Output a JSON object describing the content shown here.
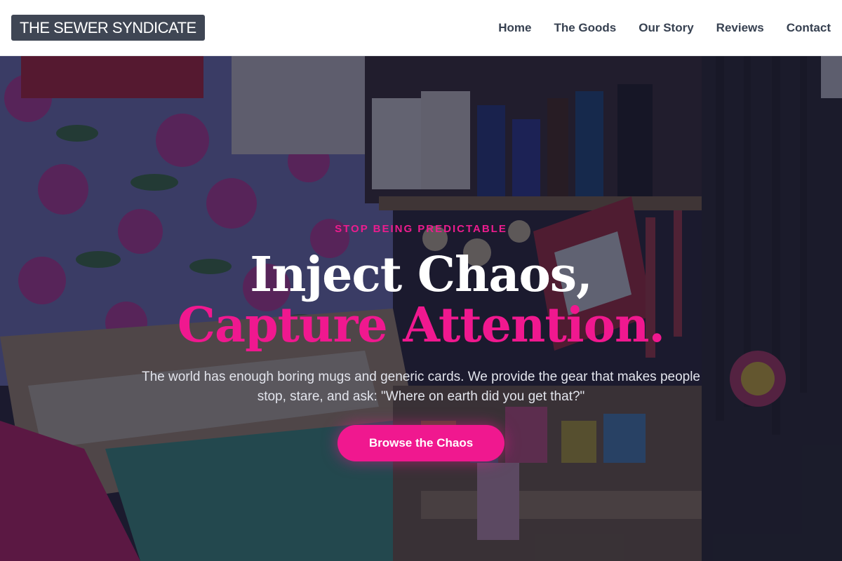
{
  "brand": {
    "name": "THE SEWER SYNDICATE"
  },
  "nav": {
    "items": [
      {
        "label": "Home"
      },
      {
        "label": "The Goods"
      },
      {
        "label": "Our Story"
      },
      {
        "label": "Reviews"
      },
      {
        "label": "Contact"
      }
    ]
  },
  "hero": {
    "eyebrow": "STOP BEING PREDICTABLE",
    "headline_line1": "Inject Chaos,",
    "headline_line2": "Capture Attention.",
    "subtext": "The world has enough boring mugs and generic cards. We provide the gear that makes people stop, stare, and ask: \"Where on earth did you get that?\"",
    "cta_label": "Browse the Chaos",
    "background_image": "souvenir-market-stall-photo"
  },
  "colors": {
    "accent": "#f0188f",
    "brand_bg": "#3f4654",
    "nav_text": "#374151",
    "overlay": "#111428"
  }
}
